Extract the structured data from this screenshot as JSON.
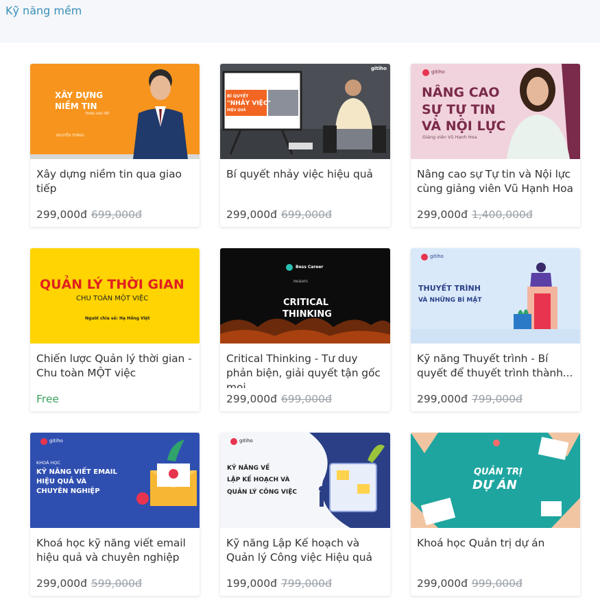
{
  "category": {
    "label": "Kỹ năng mềm"
  },
  "courses": [
    {
      "title": "Xây dựng niềm tin qua giao tiếp",
      "price": "299,000đ",
      "old_price": "699,000đ",
      "thumb": {
        "l1": "XÂY DỰNG",
        "l2": "NIỀM TIN",
        "l3": "TRONG GIAO TIẾP",
        "l4": "NGUYỄN THẮNG"
      }
    },
    {
      "title": "Bí quyết nhảy việc hiệu quả",
      "price": "299,000đ",
      "old_price": "699,000đ",
      "thumb": {
        "l1": "BÍ QUYẾT",
        "l2": "\"NHẢY VIỆC\"",
        "l3": "HIỆU QUẢ",
        "brand": "gitiho"
      }
    },
    {
      "title": "Nâng cao sự Tự tin và Nội lực cùng giảng viên Vũ Hạnh Hoa",
      "price": "299,000đ",
      "old_price": "1,400,000đ",
      "thumb": {
        "l1": "NÂNG CAO",
        "l2": "SỰ TỰ TIN",
        "l3": "VÀ NỘI LỰC",
        "l4": "Giảng viên Vũ Hạnh Hoa",
        "brand": "gitiho"
      }
    },
    {
      "title": "Chiến lược Quản lý thời gian - Chu toàn MỘT việc",
      "price": "Free",
      "old_price": "",
      "thumb": {
        "l1": "QUẢN LÝ THỜI GIAN",
        "l2": "CHU TOÀN MỘT VIỆC",
        "l3": "Người chia sẻ: Hạ Hồng Việt"
      }
    },
    {
      "title": "Critical Thinking - Tư duy phản biện, giải quyết tận gốc mọi...",
      "price": "299,000đ",
      "old_price": "699,000đ",
      "thumb": {
        "l1": "Bess Career",
        "l2": "PRESENTS",
        "l3": "CRITICAL",
        "l4": "THINKING"
      }
    },
    {
      "title": "Kỹ năng Thuyết trình - Bí quyết để thuyết trình thành...",
      "price": "299,000đ",
      "old_price": "799,000đ",
      "thumb": {
        "l1": "THUYẾT TRÌNH",
        "l2": "VÀ NHỮNG BÍ MẬT",
        "brand": "gitiho"
      }
    },
    {
      "title": "Khoá học kỹ năng viết email hiệu quả và chuyên nghiệp",
      "price": "299,000đ",
      "old_price": "599,000đ",
      "thumb": {
        "l1": "KHOÁ HỌC",
        "l2": "KỸ NĂNG VIẾT EMAIL",
        "l3": "HIỆU QUẢ VÀ",
        "l4": "CHUYÊN NGHIỆP",
        "brand": "gitiho"
      }
    },
    {
      "title": "Kỹ năng Lập Kế hoạch và Quản lý Công việc Hiệu quả",
      "price": "199,000đ",
      "old_price": "799,000đ",
      "thumb": {
        "l1": "KỸ NĂNG VỀ",
        "l2": "LẬP KẾ HOẠCH VÀ",
        "l3": "QUẢN LÝ CÔNG VIỆC",
        "brand": "gitiho"
      }
    },
    {
      "title": "Khoá học Quản trị dự án",
      "price": "299,000đ",
      "old_price": "999,000đ",
      "thumb": {
        "l1": "QUẢN TRỊ",
        "l2": "DỰ ÁN"
      }
    }
  ],
  "colors": {
    "accent": "#3a8fb7",
    "free": "#3aa25a",
    "brand": "#e8344e"
  }
}
